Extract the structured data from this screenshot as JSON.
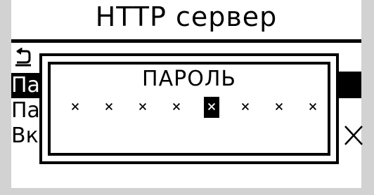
{
  "header": {
    "title": "HTTP сервер"
  },
  "menu": {
    "back_icon": "back-arrow-icon",
    "items": [
      {
        "label": "Па",
        "selected": true
      },
      {
        "label": "Па",
        "selected": false
      },
      {
        "label": "Вк",
        "selected": false
      }
    ],
    "right_value_icon": "close-icon"
  },
  "dialog": {
    "title": "ПАРОЛЬ",
    "password_chars": [
      "×",
      "×",
      "×",
      "×",
      "×",
      "×",
      "×",
      "×"
    ],
    "cursor_index": 4
  },
  "colors": {
    "background": "#ffffff",
    "foreground": "#000000",
    "frame": "#d2d2d2"
  }
}
